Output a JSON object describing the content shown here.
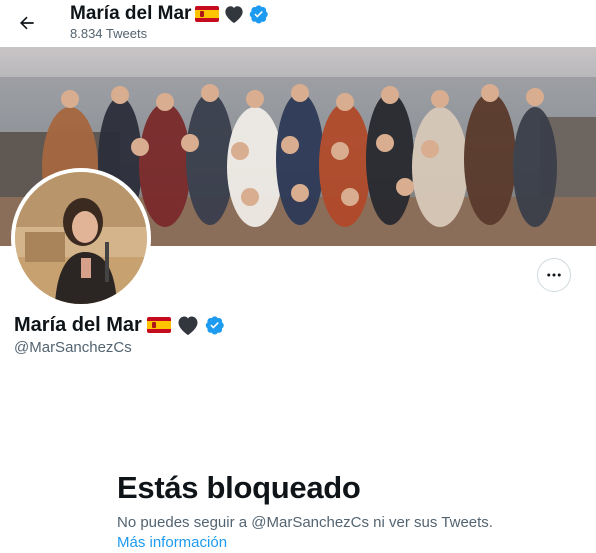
{
  "header": {
    "back_icon": "arrow-left-icon",
    "name": "María del Mar",
    "tweet_count": "8.834 Tweets"
  },
  "profile": {
    "display_name": "María del Mar",
    "handle": "@MarSanchezCs",
    "emojis": [
      "spain-flag-icon",
      "black-heart-icon"
    ],
    "verified_icon": "verified-badge-icon",
    "more_icon": "more-dots-icon"
  },
  "blocked": {
    "title": "Estás bloqueado",
    "description": "No puedes seguir a @MarSanchezCs ni ver sus Tweets.",
    "link": "Más información"
  },
  "colors": {
    "accent": "#1d9bf0",
    "secondary_text": "#536471",
    "primary_text": "#0f1419",
    "border": "#cfd9de"
  }
}
